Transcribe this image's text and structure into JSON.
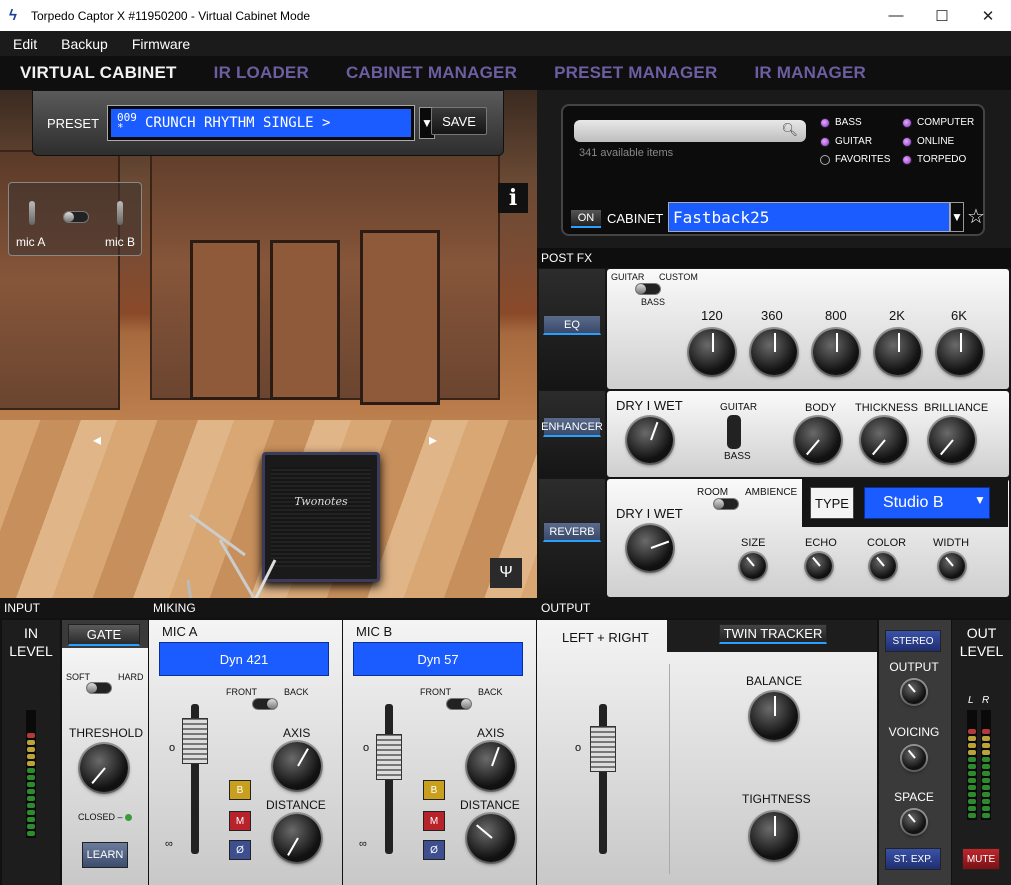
{
  "window": {
    "title": "Torpedo Captor X #11950200 - Virtual Cabinet Mode",
    "minimize": "—",
    "maximize": "☐",
    "close": "✕"
  },
  "menu": [
    "Edit",
    "Backup",
    "Firmware"
  ],
  "tabs": [
    "VIRTUAL CABINET",
    "IR LOADER",
    "CABINET MANAGER",
    "PRESET MANAGER",
    "IR MANAGER"
  ],
  "preset": {
    "label": "PRESET",
    "number": "009\n*",
    "name": "CRUNCH RHYTHM SINGLE >",
    "save": "SAVE"
  },
  "room": {
    "mic_a": "mic A",
    "mic_b": "mic B",
    "info": "i",
    "cab_brand": "Twonotes",
    "left_arrow": "◂",
    "right_arrow": "▸"
  },
  "cabinet": {
    "search_placeholder": "",
    "available": "341 available items",
    "filters": [
      {
        "label": "BASS",
        "on": true
      },
      {
        "label": "COMPUTER",
        "on": true
      },
      {
        "label": "GUITAR",
        "on": true
      },
      {
        "label": "ONLINE",
        "on": true
      },
      {
        "label": "FAVORITES",
        "on": false
      },
      {
        "label": "TORPEDO",
        "on": true
      }
    ],
    "on": "ON",
    "label": "CABINET",
    "name": "Fastback25"
  },
  "postfx": {
    "title": "POST FX",
    "eq": {
      "button": "EQ",
      "mode_left": "GUITAR",
      "mode_right": "CUSTOM",
      "mode_bottom": "BASS",
      "bands": [
        "120",
        "360",
        "800",
        "2K",
        "6K"
      ]
    },
    "enhancer": {
      "button": "ENHANCER",
      "drywet": "DRY I WET",
      "mode_top": "GUITAR",
      "mode_bottom": "BASS",
      "body": "BODY",
      "thickness": "THICKNESS",
      "brilliance": "BRILLIANCE"
    },
    "reverb": {
      "button": "REVERB",
      "drywet": "DRY I WET",
      "room": "ROOM",
      "ambience": "AMBIENCE",
      "type_label": "TYPE",
      "type": "Studio B",
      "size": "SIZE",
      "echo": "ECHO",
      "color": "COLOR",
      "width": "WIDTH"
    }
  },
  "input": {
    "title": "INPUT",
    "in_level": "IN\nLEVEL",
    "gate": "GATE",
    "soft": "SOFT",
    "hard": "HARD",
    "threshold": "THRESHOLD",
    "closed": "CLOSED –",
    "learn": "LEARN"
  },
  "miking": {
    "title": "MIKING",
    "mic_a": {
      "title": "MIC A",
      "model": "Dyn 421",
      "front": "FRONT",
      "back": "BACK",
      "axis": "AXIS",
      "distance": "DISTANCE"
    },
    "mic_b": {
      "title": "MIC B",
      "model": "Dyn 57",
      "front": "FRONT",
      "back": "BACK",
      "axis": "AXIS",
      "distance": "DISTANCE"
    },
    "btn_b": "B",
    "btn_m": "M",
    "btn_phase": "Ø"
  },
  "output": {
    "title": "OUTPUT",
    "left_right": "LEFT + RIGHT",
    "twin_tracker": "TWIN TRACKER",
    "balance": "BALANCE",
    "tightness": "TIGHTNESS",
    "stereo": "STEREO",
    "output": "OUTPUT",
    "voicing": "VOICING",
    "space": "SPACE",
    "st_exp": "ST. EXP.",
    "out_level": "OUT\nLEVEL",
    "l": "L",
    "r": "R",
    "mute": "MUTE"
  },
  "colors": {
    "lcd": "#1a5cff",
    "accent": "#29a0ff",
    "tab_inactive": "#6d5ea1"
  }
}
